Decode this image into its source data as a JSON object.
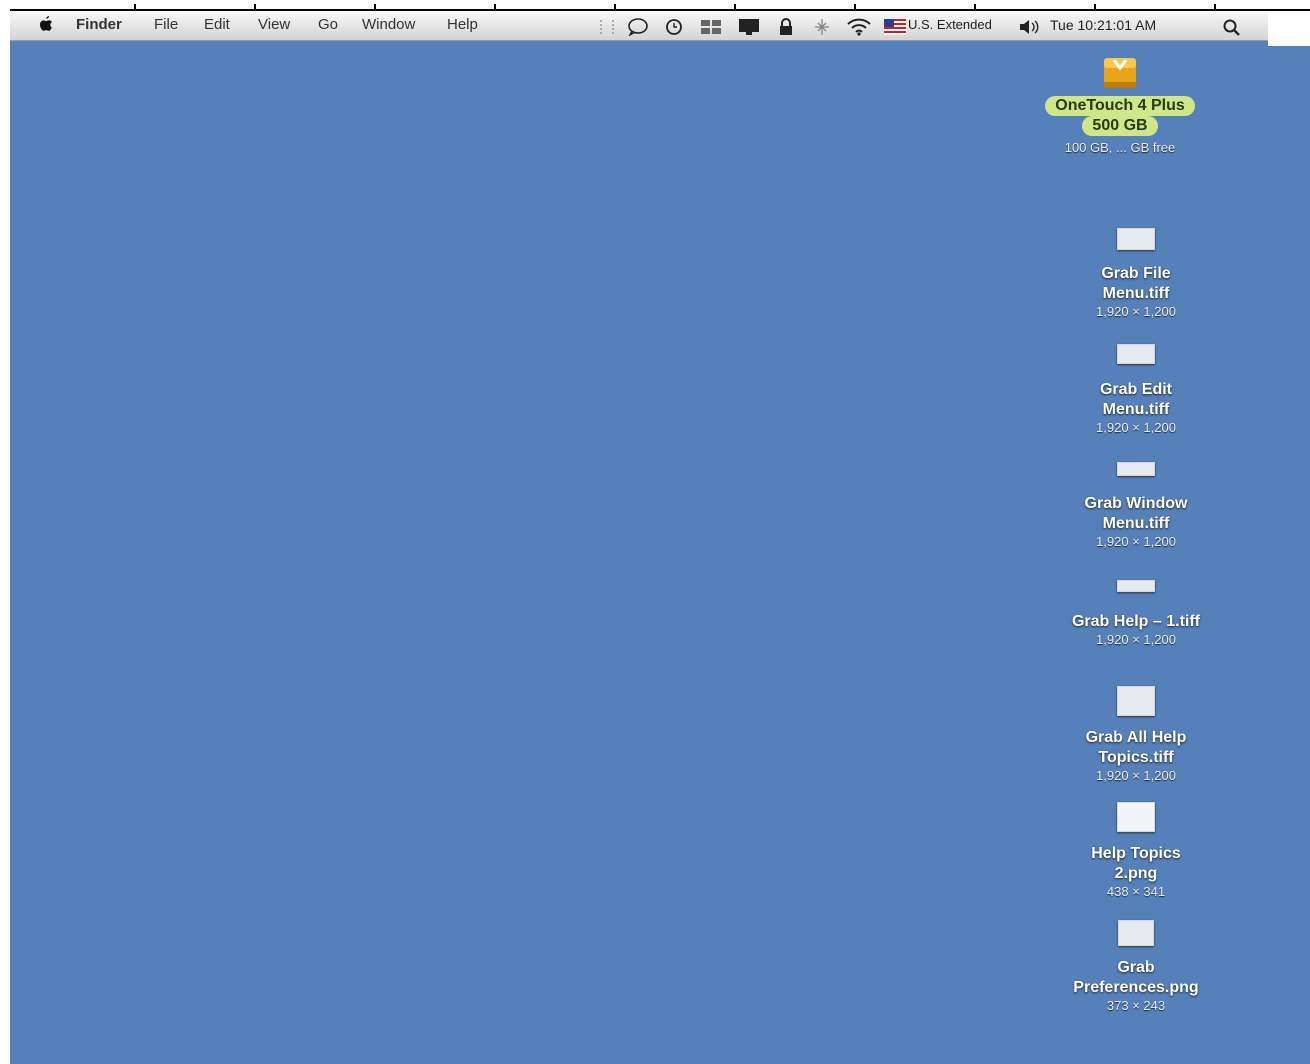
{
  "menubar": {
    "apple_label": "",
    "items": [
      "Finder",
      "File",
      "Edit",
      "View",
      "Go",
      "Window",
      "Help"
    ],
    "extras": {
      "input_menu": "U.S. Extended",
      "clock": "Tue 10:21:01 AM"
    }
  },
  "desktop": {
    "drive": {
      "name_line1": "OneTouch 4 Plus",
      "name_line2": "500 GB",
      "info": "100 GB, ... GB free"
    },
    "files": [
      {
        "name": "Grab File\nMenu.tiff",
        "info": "1,920 × 1,200"
      },
      {
        "name": "Grab Edit\nMenu.tiff",
        "info": "1,920 × 1,200"
      },
      {
        "name": "Grab Window\nMenu.tiff",
        "info": "1,920 × 1,200"
      },
      {
        "name": "Grab Help – 1.tiff",
        "info": "1,920 × 1,200"
      },
      {
        "name": "Grab All Help\nTopics.tiff",
        "info": "1,920 × 1,200"
      },
      {
        "name": "Help Topics\n2.png",
        "info": "438 × 341"
      },
      {
        "name": "Grab\nPreferences.png",
        "info": "373 × 243"
      }
    ]
  },
  "colors": {
    "desktop": "#5680b9",
    "drive_label_bg": "#cfe68a"
  },
  "icons": {
    "apple": "apple-icon",
    "drive": "external-drive-icon",
    "file": "image-file-icon"
  }
}
